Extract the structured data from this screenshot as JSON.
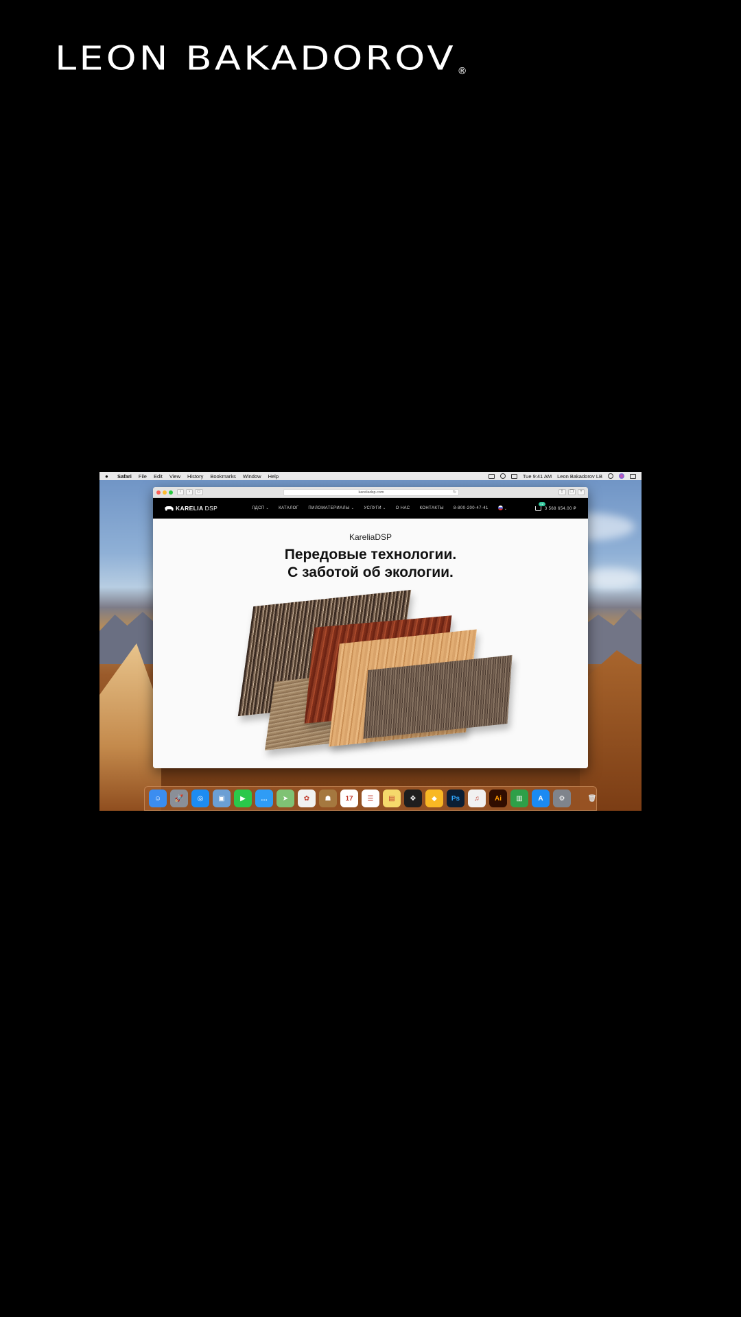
{
  "brand": {
    "name": "LEON BAKADOROV",
    "registered": "®"
  },
  "menubar": {
    "app": "Safari",
    "items": [
      "File",
      "Edit",
      "View",
      "History",
      "Bookmarks",
      "Window",
      "Help"
    ],
    "time": "Tue 9:41 AM",
    "user": "Leon Bakadorov LB"
  },
  "browser": {
    "url": "kareliadsp.com",
    "reload": "↻"
  },
  "site": {
    "logo_bold": "KARELIA",
    "logo_light": "DSP",
    "nav": [
      {
        "label": "ЛДСП",
        "dropdown": true
      },
      {
        "label": "КАТАЛОГ",
        "dropdown": false
      },
      {
        "label": "ПИЛОМАТЕРИАЛЫ",
        "dropdown": true
      },
      {
        "label": "УСЛУГИ",
        "dropdown": true
      },
      {
        "label": "О НАС",
        "dropdown": false
      },
      {
        "label": "КОНТАКТЫ",
        "dropdown": false
      }
    ],
    "phone": "8-800-200-47-41",
    "cart_total": "3 568 654.00 ₽",
    "cart_count": "12",
    "hero_subtitle": "KareliaDSP",
    "hero_title_line1": "Передовые технологии.",
    "hero_title_line2": "С заботой об экологии."
  },
  "dock": {
    "apps": [
      {
        "name": "finder-icon",
        "bg": "#3b8df0",
        "glyph": "☺"
      },
      {
        "name": "launchpad-icon",
        "bg": "#8a8f98",
        "glyph": "🚀"
      },
      {
        "name": "safari-icon",
        "bg": "#1d8cf2",
        "glyph": "◎"
      },
      {
        "name": "preview-icon",
        "bg": "#6b9fd4",
        "glyph": "▣"
      },
      {
        "name": "facetime-icon",
        "bg": "#2bc84a",
        "glyph": "▶"
      },
      {
        "name": "messages-icon",
        "bg": "#2f9cf5",
        "glyph": "…"
      },
      {
        "name": "maps-icon",
        "bg": "#7fc274",
        "glyph": "➤"
      },
      {
        "name": "photos-icon",
        "bg": "#f1f1f1",
        "glyph": "✿"
      },
      {
        "name": "contacts-icon",
        "bg": "#a5783f",
        "glyph": "☗"
      },
      {
        "name": "calendar-icon",
        "bg": "#ffffff",
        "glyph": "17"
      },
      {
        "name": "reminders-icon",
        "bg": "#ffffff",
        "glyph": "☰"
      },
      {
        "name": "notes-icon",
        "bg": "#f5d96b",
        "glyph": "▤"
      },
      {
        "name": "figma-icon",
        "bg": "#1e1e1e",
        "glyph": "✥"
      },
      {
        "name": "sketch-icon",
        "bg": "#f8b824",
        "glyph": "◆"
      },
      {
        "name": "photoshop-icon",
        "bg": "#0b1e33",
        "glyph": "Ps"
      },
      {
        "name": "itunes-icon",
        "bg": "#f1f1f1",
        "glyph": "♫"
      },
      {
        "name": "illustrator-icon",
        "bg": "#300d00",
        "glyph": "Ai"
      },
      {
        "name": "numbers-icon",
        "bg": "#2e9f48",
        "glyph": "▥"
      },
      {
        "name": "app-store-icon",
        "bg": "#1b8af2",
        "glyph": "A"
      },
      {
        "name": "system-preferences-icon",
        "bg": "#7f848c",
        "glyph": "⚙"
      }
    ],
    "trash": {
      "name": "trash-icon",
      "glyph": "🗑"
    }
  }
}
